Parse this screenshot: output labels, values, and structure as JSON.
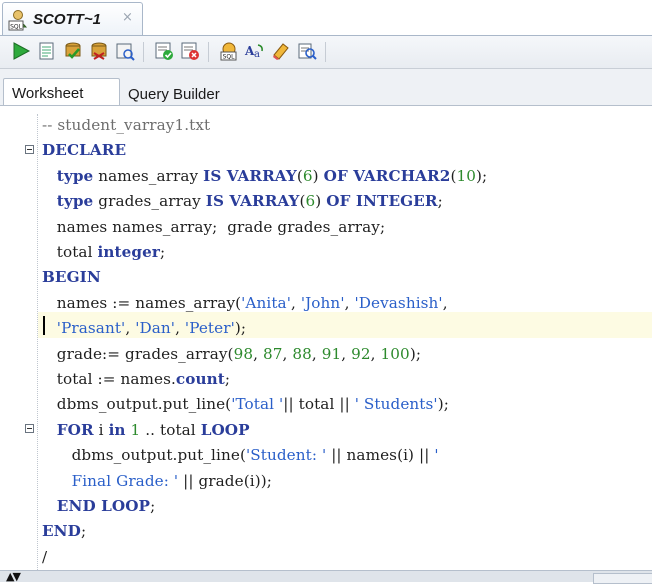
{
  "document_tab": {
    "title": "SCOTT~1",
    "close": "×"
  },
  "toolbar": {
    "buttons": [
      "run-statement-icon",
      "run-script-icon",
      "commit-icon",
      "rollback-icon",
      "explain-plan-icon",
      "autotrace-icon",
      "sql-tuning-icon",
      "sql-history-icon",
      "to-upper-lower-icon",
      "clear-eraser-icon",
      "find-icon"
    ]
  },
  "subtabs": {
    "worksheet": "Worksheet",
    "query_builder": "Query Builder"
  },
  "editor": {
    "lines": [
      [
        [
          "comment",
          "-- student_varray1.txt"
        ]
      ],
      [
        [
          "kw",
          "DECLARE"
        ]
      ],
      [
        [
          "plain",
          "   "
        ],
        [
          "kw",
          "type"
        ],
        [
          "plain",
          " names_array "
        ],
        [
          "kw",
          "IS VARRAY"
        ],
        [
          "plain",
          "("
        ],
        [
          "num",
          "6"
        ],
        [
          "plain",
          ") "
        ],
        [
          "kw",
          "OF VARCHAR2"
        ],
        [
          "plain",
          "("
        ],
        [
          "num",
          "10"
        ],
        [
          "plain",
          ");"
        ]
      ],
      [
        [
          "plain",
          "   "
        ],
        [
          "kw",
          "type"
        ],
        [
          "plain",
          " grades_array "
        ],
        [
          "kw",
          "IS VARRAY"
        ],
        [
          "plain",
          "("
        ],
        [
          "num",
          "6"
        ],
        [
          "plain",
          ") "
        ],
        [
          "kw",
          "OF INTEGER"
        ],
        [
          "plain",
          ";"
        ]
      ],
      [
        [
          "plain",
          "   names names_array;  grade grades_array;"
        ]
      ],
      [
        [
          "plain",
          "   total "
        ],
        [
          "kw",
          "integer"
        ],
        [
          "plain",
          ";"
        ]
      ],
      [
        [
          "kw",
          "BEGIN"
        ]
      ],
      [
        [
          "plain",
          "   names := names_array("
        ],
        [
          "str",
          "'Anita'"
        ],
        [
          "plain",
          ", "
        ],
        [
          "str",
          "'John'"
        ],
        [
          "plain",
          ", "
        ],
        [
          "str",
          "'Devashish'"
        ],
        [
          "plain",
          ","
        ]
      ],
      [
        [
          "plain",
          "   "
        ],
        [
          "str",
          "'Prasant'"
        ],
        [
          "plain",
          ", "
        ],
        [
          "str",
          "'Dan'"
        ],
        [
          "plain",
          ", "
        ],
        [
          "str",
          "'Peter'"
        ],
        [
          "plain",
          ");"
        ]
      ],
      [
        [
          "plain",
          "   grade:= grades_array("
        ],
        [
          "num",
          "98"
        ],
        [
          "plain",
          ", "
        ],
        [
          "num",
          "87"
        ],
        [
          "plain",
          ", "
        ],
        [
          "num",
          "88"
        ],
        [
          "plain",
          ", "
        ],
        [
          "num",
          "91"
        ],
        [
          "plain",
          ", "
        ],
        [
          "num",
          "92"
        ],
        [
          "plain",
          ", "
        ],
        [
          "num",
          "100"
        ],
        [
          "plain",
          ");"
        ]
      ],
      [
        [
          "plain",
          "   total := names."
        ],
        [
          "kw",
          "count"
        ],
        [
          "plain",
          ";"
        ]
      ],
      [
        [
          "plain",
          "   dbms_output.put_line("
        ],
        [
          "str",
          "'Total '"
        ],
        [
          "plain",
          "|| total || "
        ],
        [
          "str",
          "' Students'"
        ],
        [
          "plain",
          ");"
        ]
      ],
      [
        [
          "plain",
          "   "
        ],
        [
          "kw",
          "FOR"
        ],
        [
          "plain",
          " i "
        ],
        [
          "kw",
          "in"
        ],
        [
          "plain",
          " "
        ],
        [
          "num",
          "1"
        ],
        [
          "plain",
          " .. total "
        ],
        [
          "kw",
          "LOOP"
        ]
      ],
      [
        [
          "plain",
          "      dbms_output.put_line("
        ],
        [
          "str",
          "'Student: '"
        ],
        [
          "plain",
          " || names(i) || "
        ],
        [
          "str",
          "'"
        ]
      ],
      [
        [
          "str",
          "      Final Grade: '"
        ],
        [
          "plain",
          " || grade(i));"
        ]
      ],
      [
        [
          "plain",
          "   "
        ],
        [
          "kw",
          "END LOOP"
        ],
        [
          "plain",
          ";"
        ]
      ],
      [
        [
          "kw",
          "END"
        ],
        [
          "plain",
          ";"
        ]
      ],
      [
        [
          "plain",
          "/"
        ]
      ]
    ]
  },
  "bottom_bar": {
    "split_arrows": "▲▼"
  }
}
